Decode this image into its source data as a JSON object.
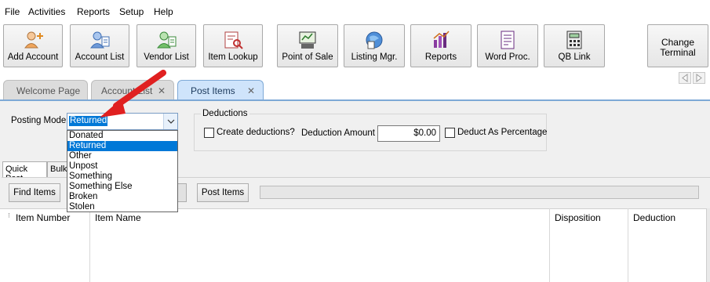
{
  "menu": [
    "File",
    "Activities",
    "Reports",
    "Setup",
    "Help"
  ],
  "toolbar": {
    "buttons": [
      {
        "label": "Add Account",
        "icon": "add-account-icon"
      },
      {
        "label": "Account List",
        "icon": "account-list-icon"
      },
      {
        "label": "Vendor List",
        "icon": "vendor-list-icon"
      },
      {
        "label": "Item Lookup",
        "icon": "item-lookup-icon"
      },
      {
        "label": "Point of Sale",
        "icon": "point-of-sale-icon"
      },
      {
        "label": "Listing Mgr.",
        "icon": "listing-manager-icon"
      },
      {
        "label": "Reports",
        "icon": "reports-icon"
      },
      {
        "label": "Word Proc.",
        "icon": "word-processor-icon"
      },
      {
        "label": "QB Link",
        "icon": "qb-link-icon"
      }
    ],
    "change_terminal": [
      "Change",
      "Terminal"
    ]
  },
  "tabs": [
    {
      "label": "Welcome Page",
      "closable": false
    },
    {
      "label": "Account List",
      "closable": true
    },
    {
      "label": "Post Items",
      "closable": true,
      "active": true
    }
  ],
  "posting": {
    "label": "Posting Mode",
    "selected": "Returned",
    "options": [
      "Donated",
      "Returned",
      "Other",
      "Unpost",
      "Something",
      "Something Else",
      "Broken",
      "Stolen"
    ]
  },
  "deductions": {
    "title": "Deductions",
    "create_label": "Create deductions?",
    "amount_label": "Deduction Amount",
    "amount_value": "$0.00",
    "percentage_label": "Deduct As Percentage"
  },
  "subtabs": [
    "Quick Post",
    "Bulk"
  ],
  "actions": {
    "find": "Find Items",
    "post": "Post Items"
  },
  "grid": {
    "columns": [
      "Item Number",
      "Item Name",
      "Disposition",
      "Deduction"
    ]
  },
  "colors": {
    "accent": "#0078d7",
    "annotation_arrow": "#e02020",
    "active_tab": "#cfe4fb"
  }
}
